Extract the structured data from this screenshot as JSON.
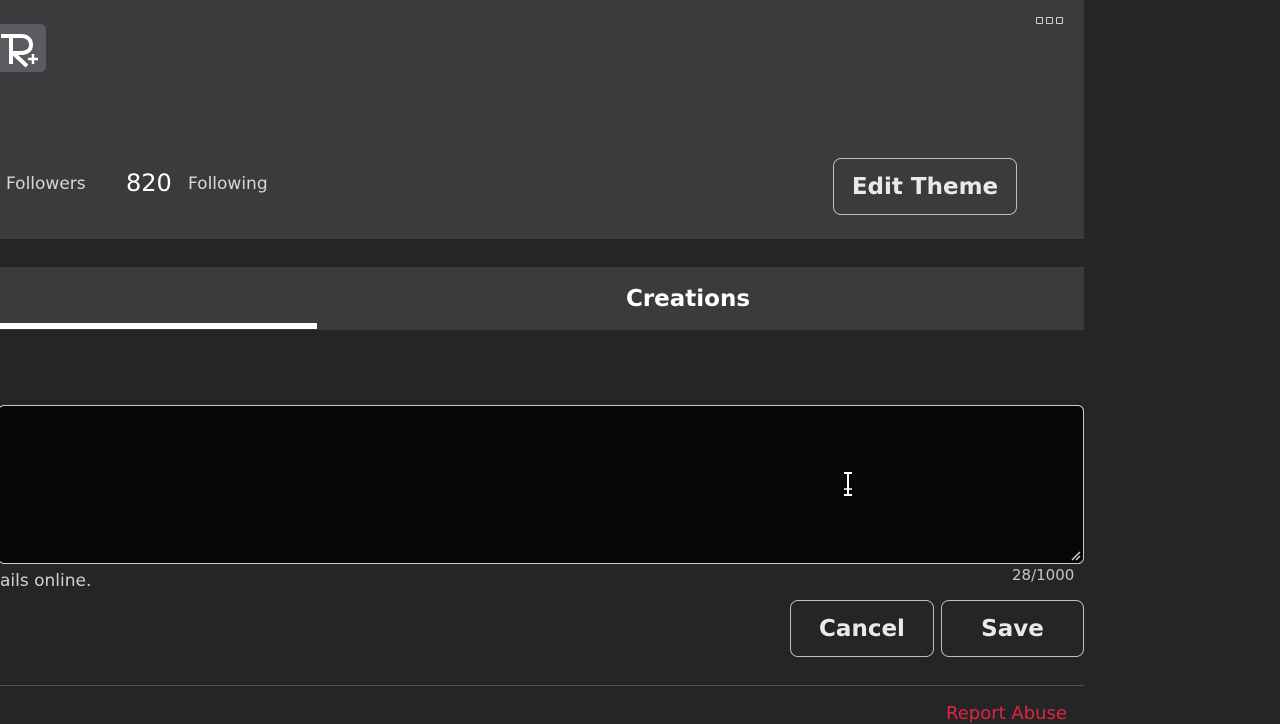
{
  "header": {
    "stats": {
      "followers_label": "Followers",
      "following_count": "820",
      "following_label": "Following"
    },
    "edit_theme_label": "Edit Theme",
    "more_icon": "more-options-icon",
    "extension_icon": "roblox-plus-extension-icon"
  },
  "tabs": {
    "creations_label": "Creations"
  },
  "about": {
    "hint_text": "ails online.",
    "char_counter": "28/1000"
  },
  "actions": {
    "cancel_label": "Cancel",
    "save_label": "Save"
  },
  "footer": {
    "report_label": "Report Abuse"
  },
  "colors": {
    "card_bg": "#393b3d",
    "page_bg": "#232527",
    "report_red": "#e2243f"
  }
}
